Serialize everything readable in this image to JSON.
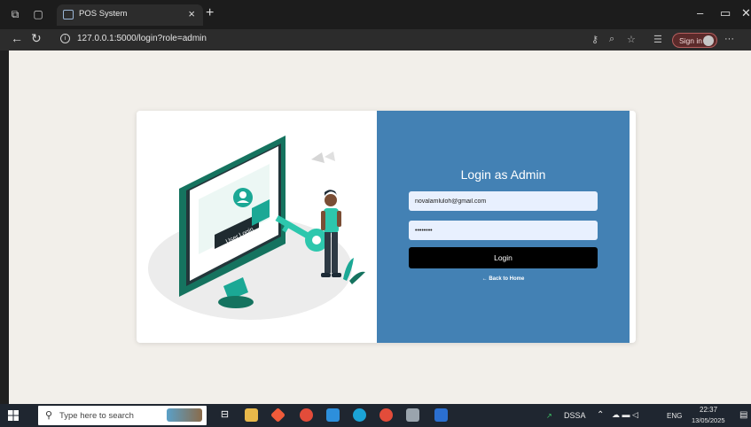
{
  "browser": {
    "tab_title": "POS System",
    "tab_close": "×",
    "new_tab": "+",
    "url": "127.0.0.1:5000/login?role=admin",
    "signin_label": "Sign in",
    "more_label": "···",
    "win_min": "–",
    "win_restore": "▭",
    "win_close": "✕"
  },
  "illustration": {
    "label": "User Login"
  },
  "login": {
    "title": "Login as Admin",
    "email_value": "novalamluloh@gmail.com",
    "password_value": "••••••••",
    "button_label": "Login",
    "back_link": "← Back to Home"
  },
  "taskbar": {
    "search_placeholder": "Type here to search",
    "dssa_label": "DSSA",
    "language": "ENG",
    "time": "22:37",
    "date": "13/05/2025"
  },
  "colors": {
    "panel": "#4381b4",
    "accent": "#1ba895",
    "button": "#000000"
  }
}
